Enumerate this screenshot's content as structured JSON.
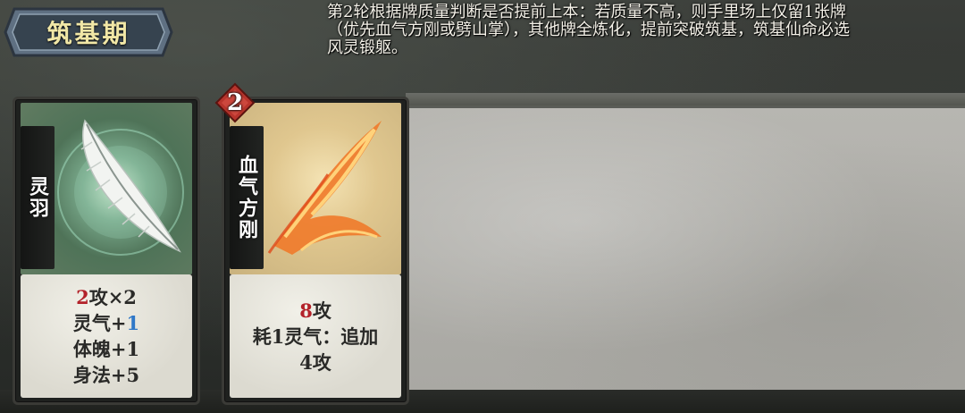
{
  "stage": {
    "title": "筑基期"
  },
  "tip": {
    "line1": "第2轮根据牌质量判断是否提前上本：若质量不高，则手里场上仅留1张牌",
    "line2": "（优先血气方刚或劈山掌），其他牌全炼化，提前突破筑基，筑基仙命必选",
    "line3": "风灵锻躯。"
  },
  "cards": [
    {
      "name": "灵羽",
      "effects": {
        "line1_red": "2",
        "line1_rest": "攻×2",
        "line2_pre": "灵气+",
        "line2_blue": "1",
        "line3": "体魄+1",
        "line4": "身法+5"
      },
      "art_icon": "feather-icon"
    },
    {
      "name": "血气方刚",
      "cost": "2",
      "effects": {
        "line1_red": "8",
        "line1_rest": "攻",
        "line2": "耗1灵气：追加",
        "line3": "4攻"
      },
      "art_icon": "flame-slash-icon"
    }
  ],
  "colors": {
    "accent_gold": "#f1e7a6",
    "attack_red": "#b3222a",
    "qi_blue": "#2f78c8"
  }
}
